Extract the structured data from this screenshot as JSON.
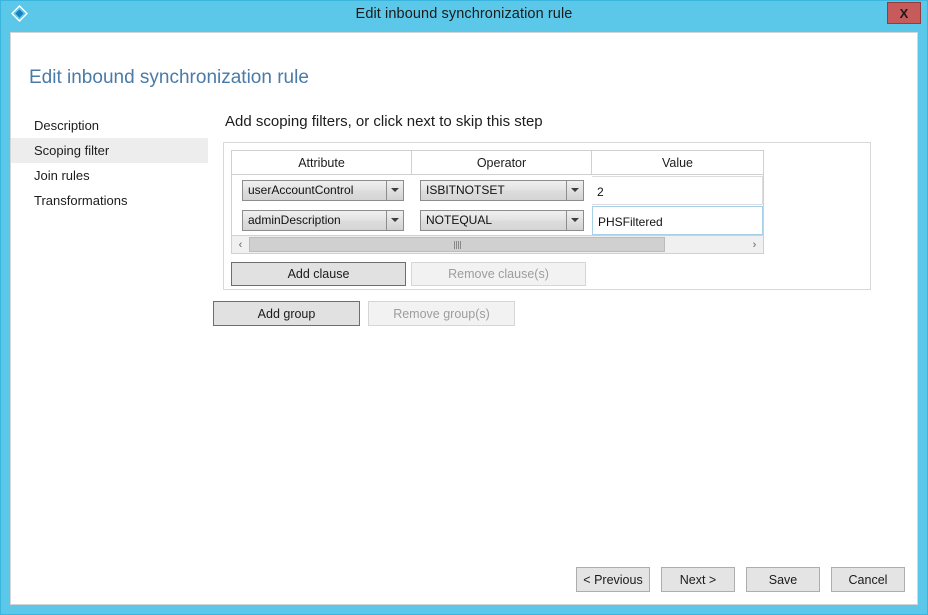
{
  "window": {
    "title": "Edit inbound synchronization rule",
    "icon": "azure-diamond-icon",
    "close_label": "X",
    "titlebar_color": "#5bc8ea",
    "close_color": "#c75b5b"
  },
  "page": {
    "title": "Edit inbound synchronization rule",
    "title_color": "#4a7ba8"
  },
  "sidebar": {
    "items": [
      {
        "label": "Description",
        "selected": false
      },
      {
        "label": "Scoping filter",
        "selected": true
      },
      {
        "label": "Join rules",
        "selected": false
      },
      {
        "label": "Transformations",
        "selected": false
      }
    ],
    "selected_bg": "#ededed"
  },
  "main": {
    "heading": "Add scoping filters, or click next to skip this step",
    "grid": {
      "columns": [
        "Attribute",
        "Operator",
        "Value"
      ],
      "rows": [
        {
          "attribute": "userAccountControl",
          "operator": "ISBITNOTSET",
          "value": "2",
          "value_focused": false
        },
        {
          "attribute": "adminDescription",
          "operator": "NOTEQUAL",
          "value": "PHSFiltered",
          "value_focused": true
        }
      ]
    },
    "scrollbar": {
      "left_arrow": "‹",
      "right_arrow": "›"
    },
    "clause_buttons": [
      {
        "label": "Add clause",
        "disabled": false
      },
      {
        "label": "Remove clause(s)",
        "disabled": true
      }
    ],
    "group_buttons": [
      {
        "label": "Add group",
        "disabled": false
      },
      {
        "label": "Remove group(s)",
        "disabled": true
      }
    ]
  },
  "footer": {
    "buttons": [
      {
        "label": "< Previous"
      },
      {
        "label": "Next >"
      },
      {
        "label": "Save"
      },
      {
        "label": "Cancel"
      }
    ]
  }
}
